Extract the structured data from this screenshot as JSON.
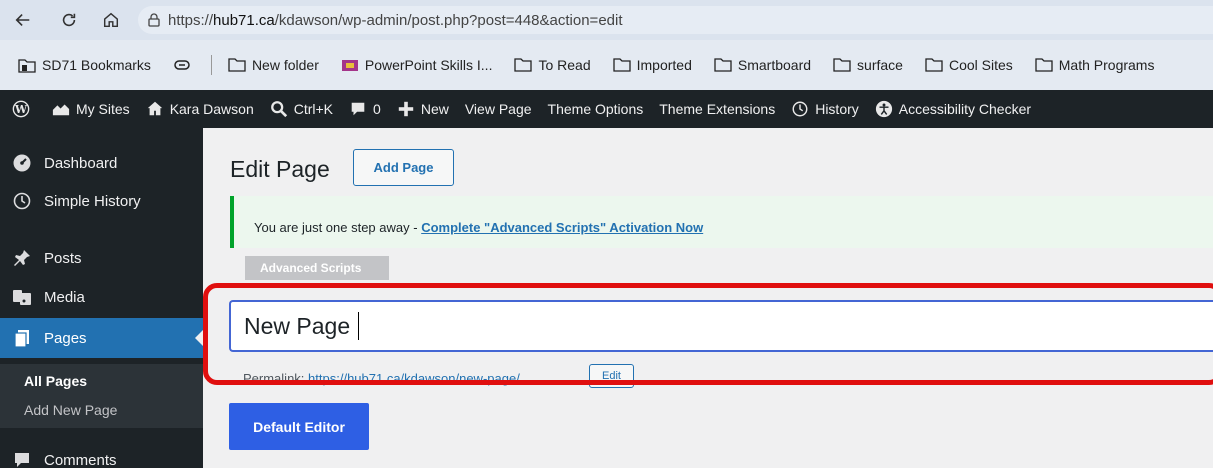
{
  "browser": {
    "url_prefix": "https://",
    "url_domain": "hub71.ca",
    "url_rest": "/kdawson/wp-admin/post.php?post=448&action=edit"
  },
  "bookmarks": [
    {
      "label": "SD71 Bookmarks",
      "icon": "bookmarks-folder-icon"
    },
    {
      "label": "",
      "icon": "reading-list-icon"
    },
    {
      "label": "New folder",
      "icon": "folder-icon"
    },
    {
      "label": "PowerPoint Skills I...",
      "icon": "powerpoint-site-icon"
    },
    {
      "label": "To Read",
      "icon": "folder-icon"
    },
    {
      "label": "Imported",
      "icon": "folder-icon"
    },
    {
      "label": "Smartboard",
      "icon": "folder-icon"
    },
    {
      "label": "surface",
      "icon": "folder-icon"
    },
    {
      "label": "Cool Sites",
      "icon": "folder-icon"
    },
    {
      "label": "Math Programs",
      "icon": "folder-icon"
    }
  ],
  "admin_bar": {
    "my_sites": "My Sites",
    "site_name": "Kara Dawson",
    "search": "Ctrl+K",
    "comments_count": "0",
    "new": "New",
    "view_page": "View Page",
    "theme_options": "Theme Options",
    "theme_extensions": "Theme Extensions",
    "history": "History",
    "accessibility": "Accessibility Checker"
  },
  "sidebar": {
    "items": [
      {
        "label": "Dashboard",
        "icon": "dashboard-icon"
      },
      {
        "label": "Simple History",
        "icon": "history-icon"
      },
      {
        "label": "Posts",
        "icon": "pin-icon"
      },
      {
        "label": "Media",
        "icon": "media-icon"
      },
      {
        "label": "Pages",
        "icon": "pages-icon"
      },
      {
        "label": "Comments",
        "icon": "comments-icon"
      }
    ],
    "submenu": [
      "All Pages",
      "Add New Page"
    ]
  },
  "main": {
    "title": "Edit Page",
    "add_page": "Add Page",
    "notice_text": "You are just one step away - ",
    "notice_link": "Complete \"Advanced Scripts\" Activation Now",
    "advanced_tab": "Advanced Scripts",
    "page_title_value": "New Page",
    "permalink_label": "Permalink:",
    "permalink_base": "https://hub71.ca/kdawson/",
    "permalink_slug": "new-page",
    "permalink_trailing": "/",
    "edit_label": "Edit",
    "default_editor": "Default Editor"
  },
  "colors": {
    "admin_dark": "#1d2327",
    "accent_blue": "#2271b1",
    "notice_green": "#00a32a",
    "highlight_red": "#e00f0f"
  }
}
